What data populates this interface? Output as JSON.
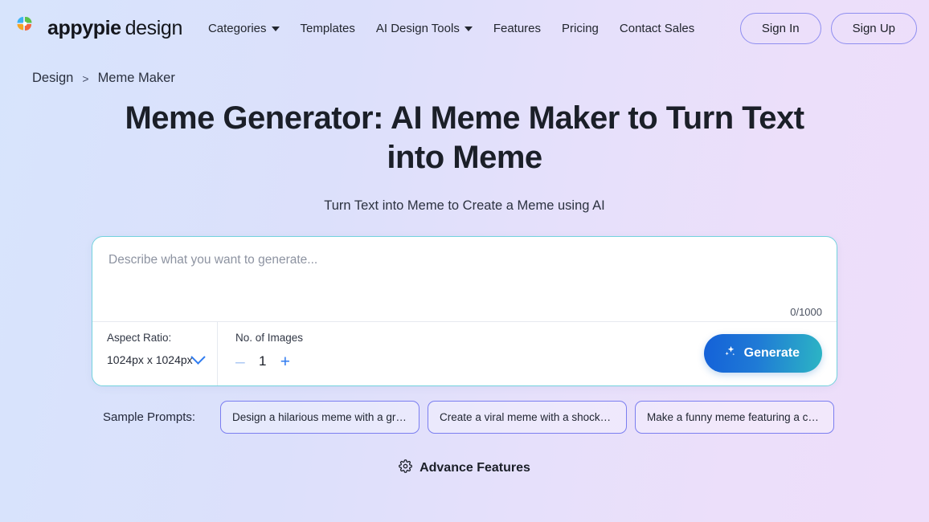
{
  "header": {
    "brand": {
      "word1": "appypie",
      "word2": "design",
      "logo_icon": "appypie-pinwheel-logo"
    },
    "nav": [
      {
        "label": "Categories",
        "has_dropdown": true
      },
      {
        "label": "Templates",
        "has_dropdown": false
      },
      {
        "label": "AI Design Tools",
        "has_dropdown": true
      },
      {
        "label": "Features",
        "has_dropdown": false
      },
      {
        "label": "Pricing",
        "has_dropdown": false
      },
      {
        "label": "Contact Sales",
        "has_dropdown": false
      }
    ],
    "sign_in": "Sign In",
    "sign_up": "Sign Up",
    "auth_border_color": "#8f8ef0"
  },
  "breadcrumb": {
    "root": "Design",
    "separator": ">",
    "current": "Meme Maker"
  },
  "hero": {
    "title": "Meme Generator: AI Meme Maker to Turn Text into Meme",
    "subtitle": "Turn Text into Meme to Create a Meme using AI"
  },
  "generator": {
    "card_border_color": "#73d2dd",
    "prompt_placeholder": "Describe what you want to generate...",
    "prompt_value": "",
    "char_count": "0/1000",
    "aspect_ratio": {
      "label": "Aspect Ratio:",
      "value": "1024px x 1024px",
      "chevron_icon": "chevron-down-icon"
    },
    "image_count": {
      "label": "No. of Images",
      "value": "1",
      "minus": "–",
      "plus": "+"
    },
    "generate": {
      "label": "Generate",
      "icon": "sparkle-icon",
      "gradient_from": "#1461d8",
      "gradient_to": "#2cb5c4"
    }
  },
  "samples": {
    "label": "Sample Prompts:",
    "chips": [
      "Design a hilarious meme with a gru...",
      "Create a viral meme with a shocked...",
      "Make a funny meme featuring a con..."
    ]
  },
  "advance": {
    "label": "Advance Features",
    "icon": "gear-icon"
  }
}
